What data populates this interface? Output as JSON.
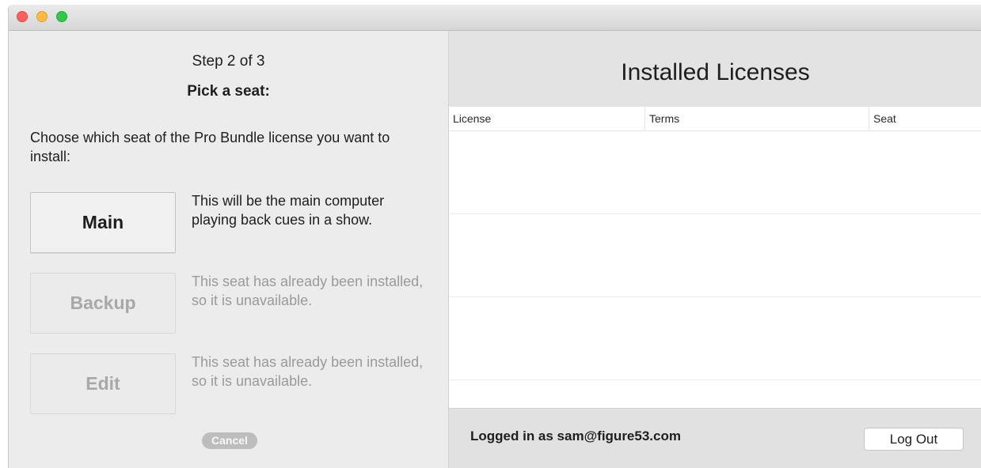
{
  "window": {
    "traffic_lights": [
      {
        "name": "close",
        "color": "#fc615d"
      },
      {
        "name": "minimize",
        "color": "#fdbc40"
      },
      {
        "name": "maximize",
        "color": "#34c84a"
      }
    ]
  },
  "wizard": {
    "step": "Step 2 of 3",
    "heading": "Pick a seat:",
    "description": "Choose which seat of the Pro Bundle license you want to install:",
    "seats": [
      {
        "label": "Main",
        "note": "This will be the main computer playing back cues in a show.",
        "enabled": true
      },
      {
        "label": "Backup",
        "note": "This seat has already been installed, so it is unavailable.",
        "enabled": false
      },
      {
        "label": "Edit",
        "note": "This seat has already been installed, so it is unavailable.",
        "enabled": false
      }
    ],
    "cancel_label": "Cancel"
  },
  "licenses": {
    "title": "Installed Licenses",
    "columns": [
      "License",
      "Terms",
      "Seat"
    ],
    "rows": []
  },
  "account": {
    "logged_in_text": "Logged in as sam@figure53.com",
    "logout_label": "Log Out"
  }
}
